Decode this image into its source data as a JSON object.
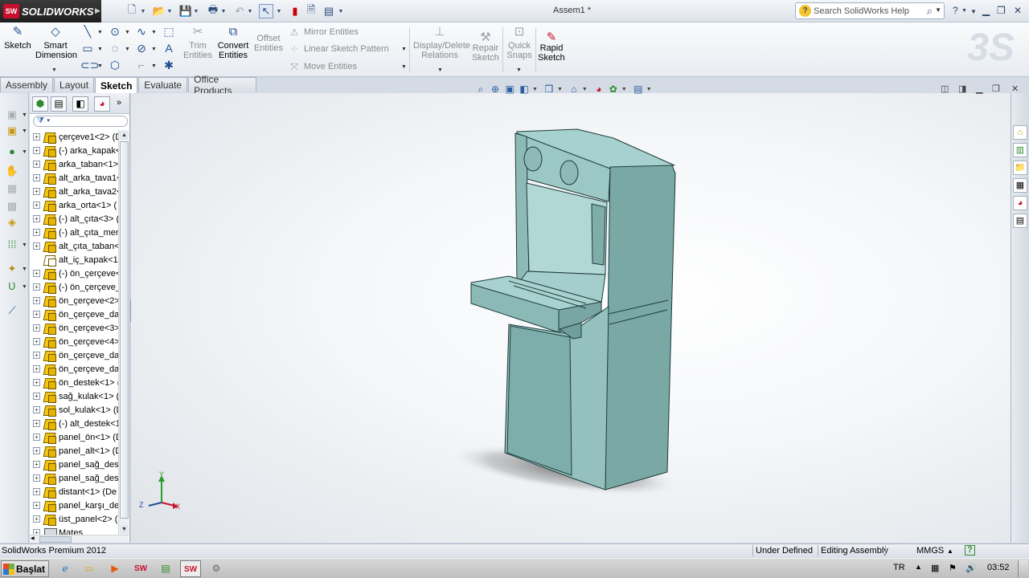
{
  "app": {
    "name": "SOLIDWORKS",
    "document_title": "Assem1 *"
  },
  "search": {
    "placeholder": "Search SolidWorks Help"
  },
  "command_manager": {
    "sketch": "Sketch",
    "smart_dimension": [
      "Smart",
      "Dimension"
    ],
    "trim": [
      "Trim",
      "Entities"
    ],
    "convert": [
      "Convert",
      "Entities"
    ],
    "offset": [
      "Offset",
      "Entities"
    ],
    "mirror": "Mirror Entities",
    "linear_pattern": "Linear Sketch Pattern",
    "move": "Move Entities",
    "display_delete": [
      "Display/Delete",
      "Relations"
    ],
    "repair": [
      "Repair",
      "Sketch"
    ],
    "quick_snaps": [
      "Quick",
      "Snaps"
    ],
    "rapid_sketch": [
      "Rapid",
      "Sketch"
    ]
  },
  "tabs": [
    {
      "label": "Assembly",
      "active": false
    },
    {
      "label": "Layout",
      "active": false
    },
    {
      "label": "Sketch",
      "active": true
    },
    {
      "label": "Evaluate",
      "active": false
    },
    {
      "label": "Office Products",
      "active": false
    }
  ],
  "tree": {
    "items": [
      {
        "label": "çerçeve1<2> (D",
        "expandable": true,
        "outline": false
      },
      {
        "label": "(-) arka_kapak<",
        "expandable": true,
        "outline": false
      },
      {
        "label": "arka_taban<1>",
        "expandable": true,
        "outline": false
      },
      {
        "label": "alt_arka_tava1<",
        "expandable": true,
        "outline": false
      },
      {
        "label": "alt_arka_tava2<",
        "expandable": true,
        "outline": false
      },
      {
        "label": "arka_orta<1> (",
        "expandable": true,
        "outline": false
      },
      {
        "label": "(-) alt_çıta<3> (",
        "expandable": true,
        "outline": false
      },
      {
        "label": "(-) alt_çıta_men",
        "expandable": true,
        "outline": false
      },
      {
        "label": "alt_çıta_taban<",
        "expandable": true,
        "outline": false
      },
      {
        "label": "alt_iç_kapak<1:",
        "expandable": false,
        "outline": true
      },
      {
        "label": "(-) ön_çerçeve<",
        "expandable": true,
        "outline": false
      },
      {
        "label": "(-) ön_çerçeve_",
        "expandable": true,
        "outline": false
      },
      {
        "label": "ön_çerçeve<2>",
        "expandable": true,
        "outline": false
      },
      {
        "label": "ön_çerçeve_day",
        "expandable": true,
        "outline": false
      },
      {
        "label": "ön_çerçeve<3>",
        "expandable": true,
        "outline": false
      },
      {
        "label": "ön_çerçeve<4>",
        "expandable": true,
        "outline": false
      },
      {
        "label": "ön_çerçeve_day",
        "expandable": true,
        "outline": false
      },
      {
        "label": "ön_çerçeve_day",
        "expandable": true,
        "outline": false
      },
      {
        "label": "ön_destek<1> (",
        "expandable": true,
        "outline": false
      },
      {
        "label": "sağ_kulak<1> (",
        "expandable": true,
        "outline": false
      },
      {
        "label": "sol_kulak<1> (D",
        "expandable": true,
        "outline": false
      },
      {
        "label": "(-) alt_destek<1",
        "expandable": true,
        "outline": false
      },
      {
        "label": "panel_ön<1> (D",
        "expandable": true,
        "outline": false
      },
      {
        "label": "panel_alt<1> (D",
        "expandable": true,
        "outline": false
      },
      {
        "label": "panel_sağ_dest",
        "expandable": true,
        "outline": false
      },
      {
        "label": "panel_sağ_dest",
        "expandable": true,
        "outline": false
      },
      {
        "label": "distant<1> (De",
        "expandable": true,
        "outline": false
      },
      {
        "label": "panel_karşı_des",
        "expandable": true,
        "outline": false
      },
      {
        "label": "üst_panel<2> (",
        "expandable": true,
        "outline": false
      },
      {
        "label": "Mates",
        "expandable": true,
        "outline": false,
        "mates": true
      }
    ]
  },
  "status": {
    "product": "SolidWorks Premium 2012",
    "defined": "Under Defined",
    "mode": "Editing Assembly",
    "units": "MMGS",
    "help": "?"
  },
  "taskbar": {
    "start": "Başlat",
    "lang": "TR",
    "time": "03:52"
  },
  "triad": {
    "x": "X",
    "y": "Y",
    "z": "Z"
  },
  "colors": {
    "model": "#9ec9c6",
    "model_dark": "#6f9e9b",
    "accent": "#1d4f97"
  }
}
